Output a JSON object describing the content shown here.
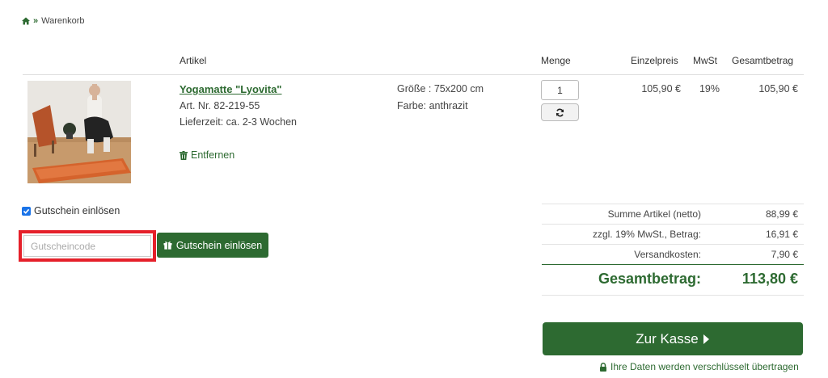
{
  "breadcrumb": {
    "current": "Warenkorb"
  },
  "table_header": {
    "article": "Artikel",
    "quantity": "Menge",
    "unit_price": "Einzelpreis",
    "vat": "MwSt",
    "total": "Gesamtbetrag"
  },
  "product": {
    "name": "Yogamatte \"Lyovita\"",
    "article_no": "Art. Nr. 82-219-55",
    "delivery": "Lieferzeit: ca. 2-3 Wochen",
    "remove_label": "Entfernen",
    "size": "Größe : 75x200 cm",
    "color": "Farbe: anthrazit",
    "quantity": "1",
    "unit_price": "105,90 €",
    "vat": "19%",
    "total": "105,90 €"
  },
  "voucher": {
    "checkbox_label": "Gutschein einlösen",
    "checked": true,
    "input_placeholder": "Gutscheincode",
    "button_label": "Gutschein einlösen"
  },
  "summary": {
    "net_label": "Summe Artikel (netto)",
    "net_value": "88,99 €",
    "vat_label": "zzgl. 19% MwSt., Betrag:",
    "vat_value": "16,91 €",
    "shipping_label": "Versandkosten:",
    "shipping_value": "7,90 €",
    "total_label": "Gesamtbetrag:",
    "total_value": "113,80 €"
  },
  "checkout": {
    "button_label": "Zur Kasse",
    "secure_note": "Ihre Daten werden verschlüsselt übertragen"
  },
  "colors": {
    "brand_green": "#2d6a31",
    "highlight_red": "#e5202a"
  }
}
